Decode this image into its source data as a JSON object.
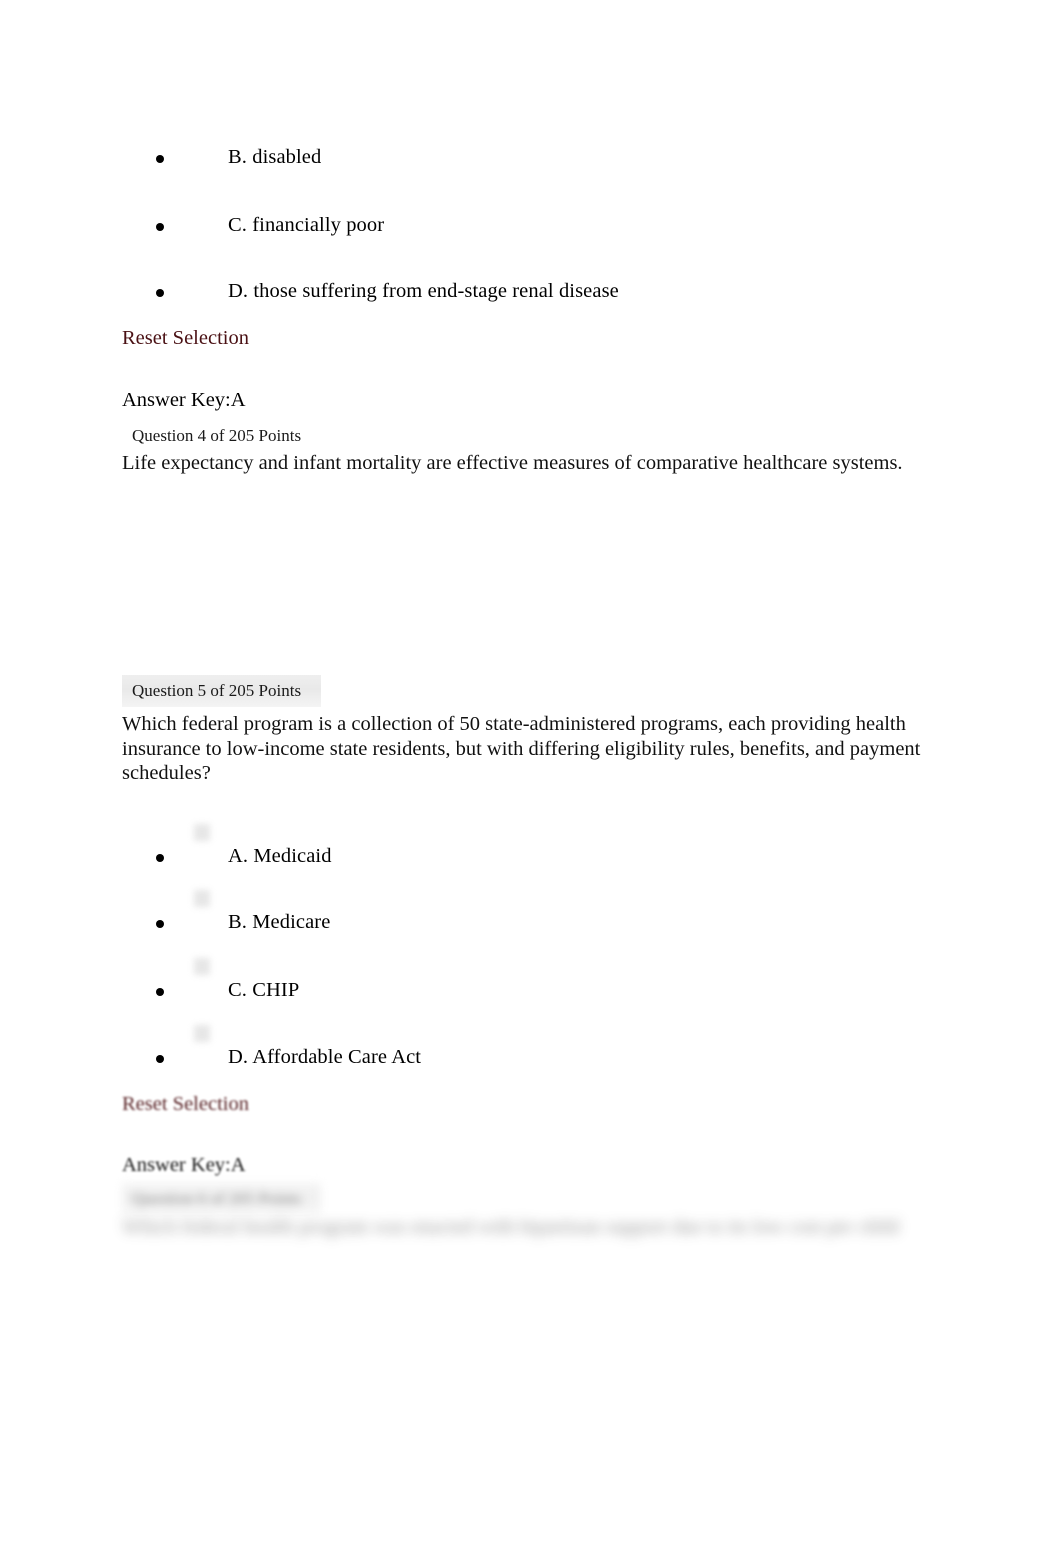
{
  "document": {
    "type": "quiz-review",
    "page_background": "#ffffff",
    "body_text_color": "#000000",
    "link_color": "#4a1114"
  },
  "question_3_options": {
    "option_b": "B. disabled",
    "option_c": "C. financially poor",
    "option_d": "D. those suffering from end-stage renal disease",
    "reset_label": "Reset Selection",
    "answer_key": "Answer Key:A"
  },
  "question_4": {
    "header": "Question 4 of 205 Points",
    "prompt": "Life expectancy and infant mortality are effective measures of comparative healthcare systems."
  },
  "question_5": {
    "header": "Question 5 of 205 Points",
    "prompt": "Which federal program is a collection of 50 state-administered programs, each providing health insurance to low-income state residents, but with differing eligibility rules, benefits, and payment schedules?",
    "options": [
      {
        "label": "A. Medicaid"
      },
      {
        "label": "B. Medicare"
      },
      {
        "label": "C. CHIP"
      },
      {
        "label": "D. Affordable Care Act"
      }
    ],
    "reset_label": "Reset Selection",
    "answer_key": "Answer Key:A"
  },
  "question_6": {
    "header": "Question 6 of 205 Points",
    "prompt": "Which federal health program was enacted with bipartisan support due to its low cost per child"
  }
}
